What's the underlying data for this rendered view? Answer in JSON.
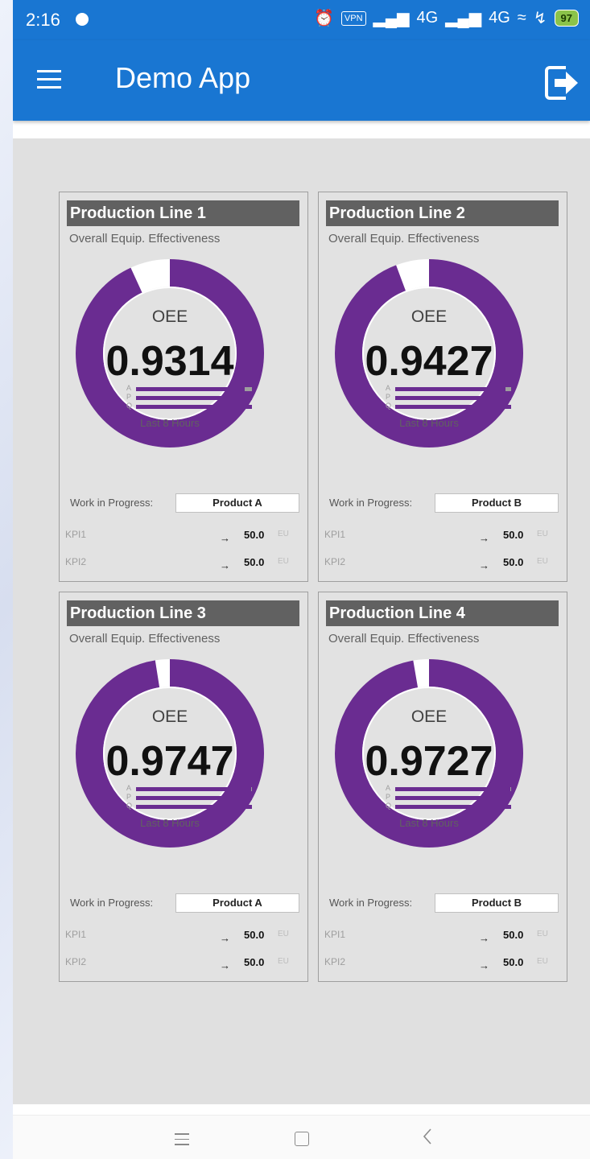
{
  "status_bar": {
    "time": "2:16",
    "vpn": "VPN",
    "network1": "4G",
    "network2": "4G",
    "battery": "97"
  },
  "app_bar": {
    "title": "Demo App"
  },
  "cards": [
    {
      "title": "Production Line 1",
      "subtitle": "Overall Equip. Effectiveness",
      "oee_label": "OEE",
      "oee_value": "0.9314",
      "oee_fraction": 0.9314,
      "bars": [
        {
          "letter": "A",
          "level": 0.94
        },
        {
          "letter": "P",
          "level": 1.0
        },
        {
          "letter": "Q",
          "level": 1.0
        }
      ],
      "period": "Last 8 Hours",
      "wip_label": "Work in Progress:",
      "wip_value": "Product A",
      "kpis": [
        {
          "name": "KPI1",
          "arrow": "→",
          "value": "50.0",
          "unit": "EU"
        },
        {
          "name": "KPI2",
          "arrow": "→",
          "value": "50.0",
          "unit": "EU"
        }
      ]
    },
    {
      "title": "Production Line 2",
      "subtitle": "Overall Equip. Effectiveness",
      "oee_label": "OEE",
      "oee_value": "0.9427",
      "oee_fraction": 0.9427,
      "bars": [
        {
          "letter": "A",
          "level": 0.95
        },
        {
          "letter": "P",
          "level": 1.0
        },
        {
          "letter": "Q",
          "level": 1.0
        }
      ],
      "period": "Last 8 Hours",
      "wip_label": "Work in Progress:",
      "wip_value": "Product B",
      "kpis": [
        {
          "name": "KPI1",
          "arrow": "→",
          "value": "50.0",
          "unit": "EU"
        },
        {
          "name": "KPI2",
          "arrow": "→",
          "value": "50.0",
          "unit": "EU"
        }
      ]
    },
    {
      "title": "Production Line 3",
      "subtitle": "Overall Equip. Effectiveness",
      "oee_label": "OEE",
      "oee_value": "0.9747",
      "oee_fraction": 0.9747,
      "bars": [
        {
          "letter": "A",
          "level": 0.99
        },
        {
          "letter": "P",
          "level": 1.0
        },
        {
          "letter": "Q",
          "level": 1.0
        }
      ],
      "period": "Last 8 Hours",
      "wip_label": "Work in Progress:",
      "wip_value": "Product A",
      "kpis": [
        {
          "name": "KPI1",
          "arrow": "→",
          "value": "50.0",
          "unit": "EU"
        },
        {
          "name": "KPI2",
          "arrow": "→",
          "value": "50.0",
          "unit": "EU"
        }
      ]
    },
    {
      "title": "Production Line 4",
      "subtitle": "Overall Equip. Effectiveness",
      "oee_label": "OEE",
      "oee_value": "0.9727",
      "oee_fraction": 0.9727,
      "bars": [
        {
          "letter": "A",
          "level": 0.99
        },
        {
          "letter": "P",
          "level": 1.0
        },
        {
          "letter": "Q",
          "level": 1.0
        }
      ],
      "period": "Last 8 Hours",
      "wip_label": "Work in Progress:",
      "wip_value": "Product B",
      "kpis": [
        {
          "name": "KPI1",
          "arrow": "→",
          "value": "50.0",
          "unit": "EU"
        },
        {
          "name": "KPI2",
          "arrow": "→",
          "value": "50.0",
          "unit": "EU"
        }
      ]
    }
  ],
  "colors": {
    "primary": "#1976d2",
    "gauge": "#6a2c91",
    "card_title_bg": "#616161",
    "content_bg": "#e0e0e0"
  },
  "icons": {
    "menu": "hamburger-icon",
    "logout": "logout-icon",
    "nav_menu": "recent-apps-icon",
    "nav_home": "home-icon",
    "nav_back": "back-icon"
  }
}
